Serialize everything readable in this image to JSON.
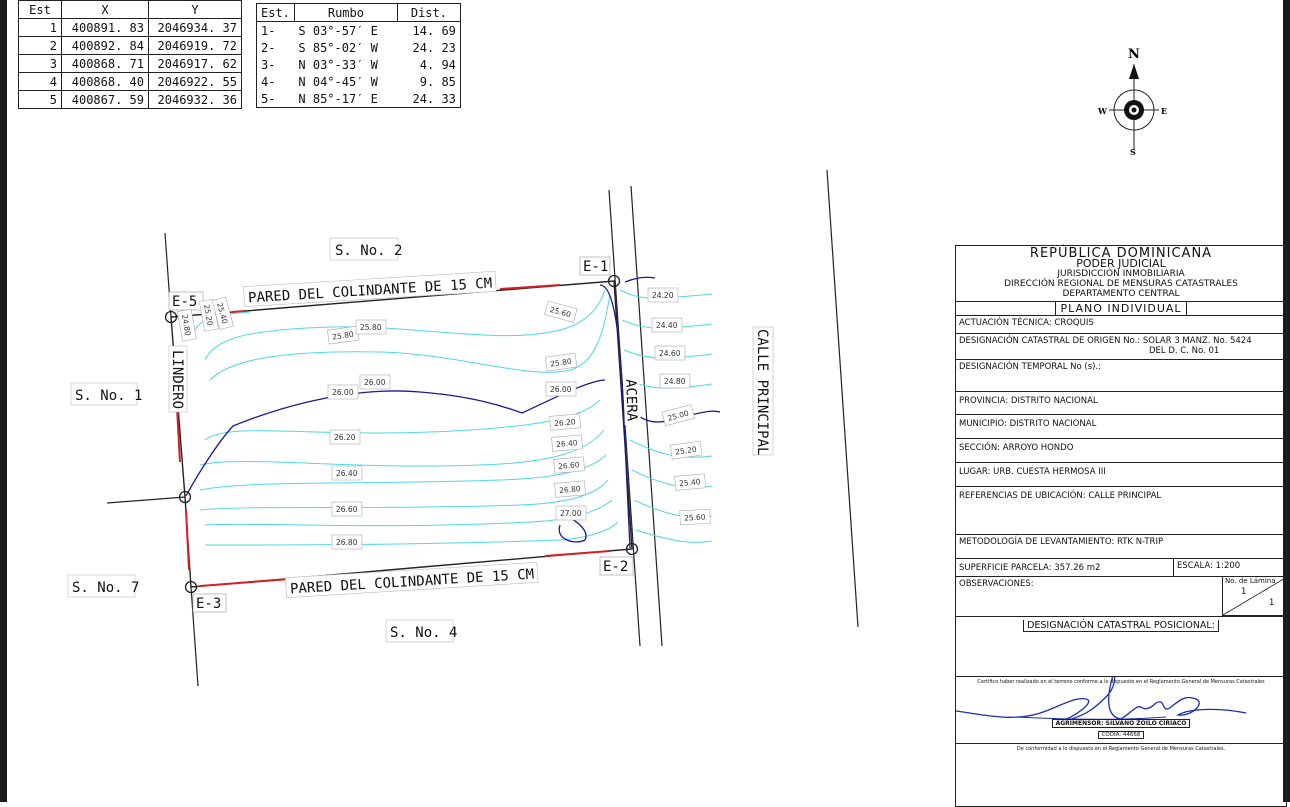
{
  "coord_table": {
    "headers": [
      "Est",
      "X",
      "Y"
    ],
    "rows": [
      [
        "1",
        "400891. 83",
        "2046934. 37"
      ],
      [
        "2",
        "400892. 84",
        "2046919. 72"
      ],
      [
        "3",
        "400868. 71",
        "2046917. 62"
      ],
      [
        "4",
        "400868. 40",
        "2046922. 55"
      ],
      [
        "5",
        "400867. 59",
        "2046932. 36"
      ]
    ]
  },
  "bearing_table": {
    "headers": [
      "Est.",
      "Rumbo",
      "Dist."
    ],
    "rows": [
      [
        "1-",
        "S 03°-57′ E",
        "14. 69"
      ],
      [
        "2-",
        "S 85°-02′ W",
        "24. 23"
      ],
      [
        "3-",
        "N 03°-33′ W",
        "4. 94"
      ],
      [
        "4-",
        "N 04°-45′ W",
        "9. 85"
      ],
      [
        "5-",
        "N 85°-17′ E",
        "24. 33"
      ]
    ]
  },
  "compass": {
    "n": "N",
    "s": "S",
    "e": "E",
    "w": "W"
  },
  "plan": {
    "vertices": {
      "e1": "E-1",
      "e2": "E-2",
      "e3": "E-3",
      "e5": "E-5"
    },
    "neighbors": {
      "s2": "S. No. 2",
      "s1": "S. No. 1",
      "s7": "S. No. 7",
      "s4": "S. No. 4"
    },
    "wall_top": "PARED DEL COLINDANTE DE 15 CM",
    "wall_bottom": "PARED DEL COLINDANTE DE 15 CM",
    "lindero": "LINDERO",
    "acera": "ACERA",
    "calle": "CALLE PRINCIPAL",
    "contour_labels": [
      "25.80",
      "25.80",
      "26.00",
      "26.00",
      "26.20",
      "26.40",
      "26.60",
      "26.80",
      "25.60",
      "25.80",
      "26.00",
      "26.20",
      "26.40",
      "26.60",
      "26.80",
      "27.00",
      "24.80",
      "25.20",
      "25.40",
      "24.20",
      "24.40",
      "24.60",
      "24.80",
      "25.00",
      "25.20",
      "25.40",
      "25.60"
    ]
  },
  "title_block": {
    "country": "REPÚBLICA  DOMINICANA",
    "power": "PODER  JUDICIAL",
    "jurisdiction": "JURISDICCIÓN INMOBILIARIA",
    "direction": "DIRECCIÓN REGIONAL DE MENSURAS CATASTRALES",
    "department": "DEPARTAMENTO CENTRAL",
    "plan_type": "PLANO  INDIVIDUAL",
    "actuacion": "ACTUACIÓN TÉCNICA: CROQUIS",
    "origen": "DESIGNACIÓN CATASTRAL DE ORIGEN No.: SOLAR 3 MANZ. No. 5424",
    "origen2": "DEL D. C. No. 01",
    "temporal": "DESIGNACIÓN TEMPORAL No (s).:",
    "provincia": "PROVINCIA: DISTRITO NACIONAL",
    "municipio": "MUNICIPIO: DISTRITO NACIONAL",
    "seccion": "SECCIÓN: ARROYO HONDO",
    "lugar": "LUGAR: URB. CUESTA HERMOSA III",
    "referencias": "REFERENCIAS DE UBICACIÓN: CALLE PRINCIPAL",
    "metodologia": "METODOLOGÍA DE LEVANTAMIENTO: RTK N-TRIP",
    "superficie": "SUPERFICIE PARCELA: 357.26 m2",
    "escala": "ESCALA:  1:200",
    "observaciones": "OBSERVACIONES:",
    "lamina_label": "No. de Lámina",
    "lamina_num": "1",
    "lamina_total": "1",
    "posicional": "DESIGNACIÓN  CATASTRAL  POSICIONAL:",
    "certifico": "Certifico haber realizado en el terreno conforme a lo dispuesto en el Reglamento General de Mensuras Catastrales",
    "agrimensor": "AGRIMENSOR:  SILVANO  ZOILO  CIRIACO",
    "codia": "CODIA:  44668",
    "conformidad": "De conformidad a lo dispuesto en el Reglamento General de Mensuras Catastrales."
  },
  "colors": {
    "contour": "#4fd8e8",
    "index_contour": "#1b1b8f",
    "wall": "#d42020",
    "line": "#222222"
  }
}
